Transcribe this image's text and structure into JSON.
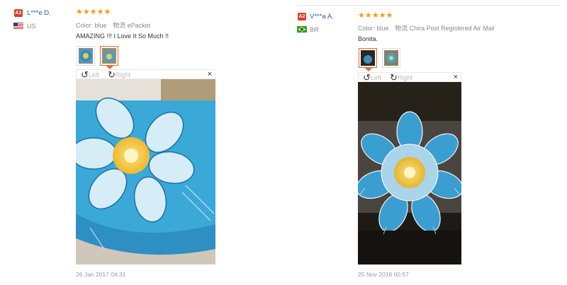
{
  "reviews": [
    {
      "avatar": "A1",
      "avatar_color": "#d7412b",
      "user": "L***e D.",
      "country": "US",
      "stars": "★★★★★",
      "color_label": "Color:",
      "color_value": "blue",
      "shipping_label": "物流",
      "shipping_value": "ePacket",
      "text": "AMAZING !!! I Love It So Much !!",
      "viewer": {
        "left": "Left",
        "right": "Right",
        "close": "×"
      },
      "date": "26 Jan 2017 04:31"
    },
    {
      "avatar": "A2",
      "avatar_color": "#d7412b",
      "user": "V***a A.",
      "country": "BR",
      "stars": "★★★★★",
      "color_label": "Color:",
      "color_value": "blue",
      "shipping_label": "物流",
      "shipping_value": "Chira Post Registered Air Mail",
      "text": "Bonita.",
      "viewer": {
        "left": "Left",
        "right": "Right",
        "close": "×"
      },
      "date": "25 Nov 2016 00:57"
    }
  ]
}
